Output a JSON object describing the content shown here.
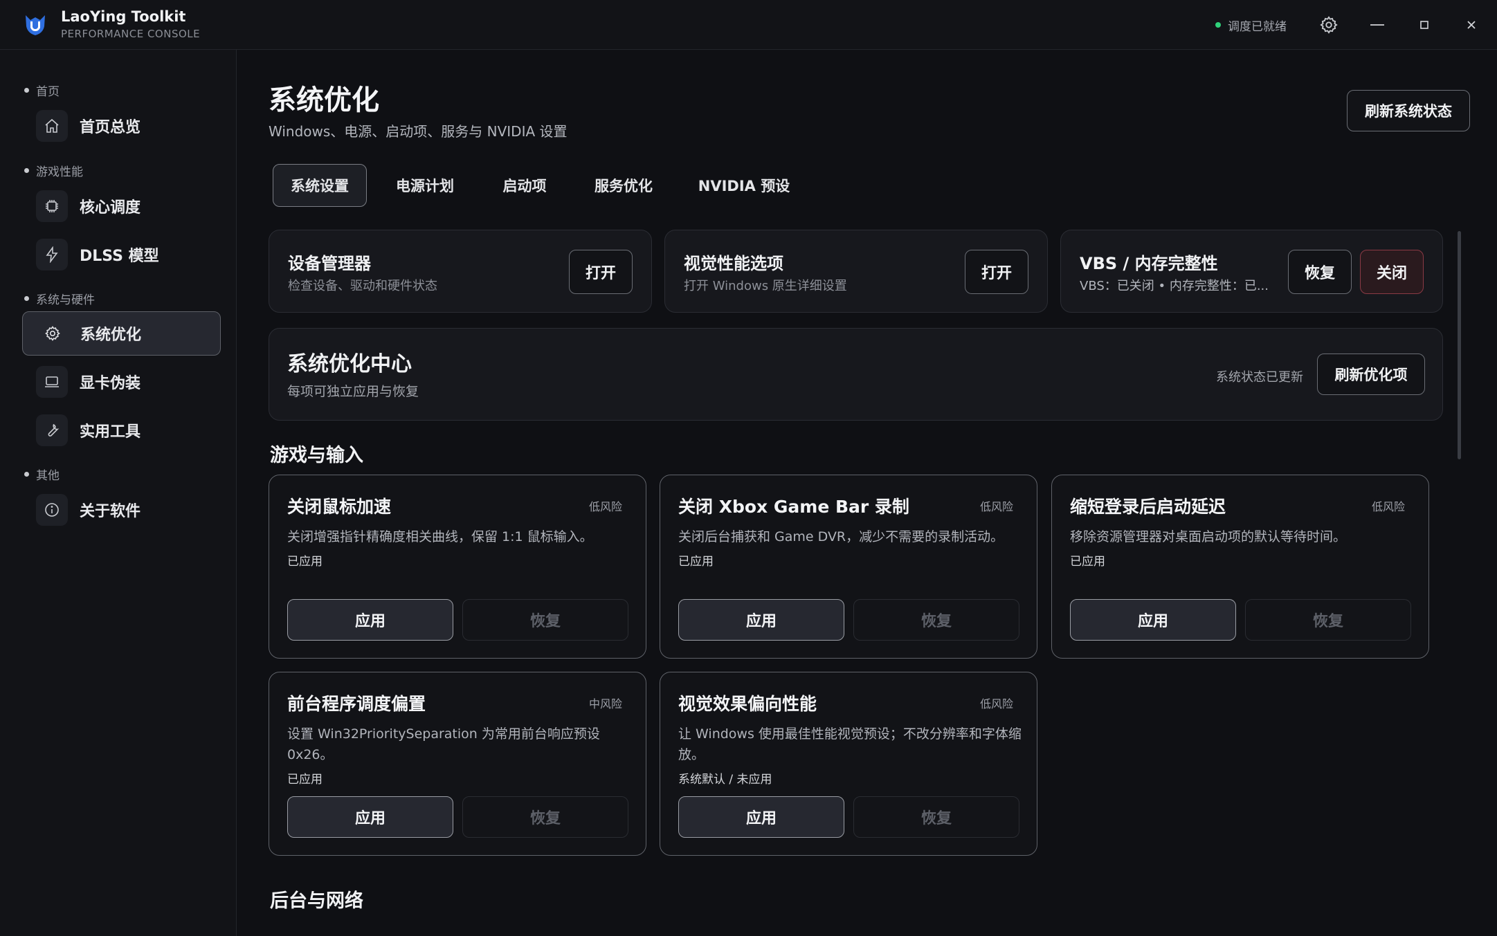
{
  "titlebar": {
    "app_name": "LaoYing Toolkit",
    "app_sub": "PERFORMANCE CONSOLE",
    "status": "调度已就绪",
    "status_color": "#2fd17a",
    "icons": [
      "app-logo",
      "settings-icon",
      "minimize-icon",
      "maximize-icon",
      "close-icon"
    ]
  },
  "sidebar": {
    "sections": [
      {
        "label": "首页",
        "items": [
          {
            "label": "首页总览",
            "icon": "home-icon"
          }
        ]
      },
      {
        "label": "游戏性能",
        "items": [
          {
            "label": "核心调度",
            "icon": "cpu-icon"
          },
          {
            "label": "DLSS 模型",
            "icon": "bolt-icon"
          }
        ]
      },
      {
        "label": "系统与硬件",
        "items": [
          {
            "label": "系统优化",
            "icon": "gear-icon",
            "active": true
          },
          {
            "label": "显卡伪装",
            "icon": "monitor-icon"
          },
          {
            "label": "实用工具",
            "icon": "wrench-icon"
          }
        ]
      },
      {
        "label": "其他",
        "items": [
          {
            "label": "关于软件",
            "icon": "info-icon"
          }
        ]
      }
    ]
  },
  "main": {
    "title": "系统优化",
    "subtitle": "Windows、电源、启动项、服务与 NVIDIA 设置",
    "refresh_button": "刷新系统状态",
    "tabs": [
      {
        "label": "系统设置",
        "active": true
      },
      {
        "label": "电源计划"
      },
      {
        "label": "启动项"
      },
      {
        "label": "服务优化"
      },
      {
        "label": "NVIDIA 预设"
      }
    ],
    "quick_panels": [
      {
        "title": "设备管理器",
        "desc": "检查设备、驱动和硬件状态",
        "button": "打开"
      },
      {
        "title": "视觉性能选项",
        "desc": "打开 Windows 原生详细设置",
        "button": "打开"
      },
      {
        "title": "VBS / 内存完整性",
        "desc": "VBS：已关闭 • 内存完整性：已...",
        "restore_button": "恢复",
        "close_button": "关闭"
      }
    ],
    "center": {
      "title": "系统优化中心",
      "desc": "每项可独立应用与恢复",
      "status": "系统状态已更新",
      "button": "刷新优化项"
    },
    "section_games": "游戏与输入",
    "section_background": "后台与网络",
    "apply_label": "应用",
    "restore_label": "恢复",
    "cards": [
      {
        "title": "关闭鼠标加速",
        "risk": "低风险",
        "desc": "关闭增强指针精确度相关曲线，保留 1:1 鼠标输入。",
        "state": "已应用"
      },
      {
        "title": "关闭 Xbox Game Bar 录制",
        "risk": "低风险",
        "desc": "关闭后台捕获和 Game DVR，减少不需要的录制活动。",
        "state": "已应用"
      },
      {
        "title": "缩短登录后启动延迟",
        "risk": "低风险",
        "desc": "移除资源管理器对桌面启动项的默认等待时间。",
        "state": "已应用"
      },
      {
        "title": "前台程序调度偏置",
        "risk": "中风险",
        "desc": "设置 Win32PrioritySeparation 为常用前台响应预设 0x26。",
        "state": "已应用"
      },
      {
        "title": "视觉效果偏向性能",
        "risk": "低风险",
        "desc": "让 Windows 使用最佳性能视觉预设；不改分辨率和字体缩放。",
        "state": "系统默认 / 未应用"
      }
    ]
  }
}
